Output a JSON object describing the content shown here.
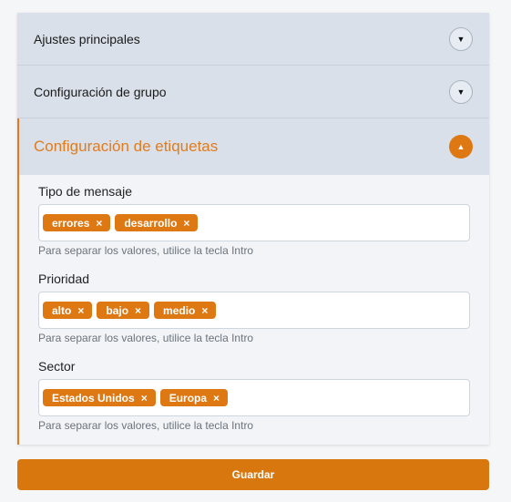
{
  "accordion": {
    "sections": [
      {
        "title": "Ajustes principales",
        "icon": "chevron-down-icon",
        "glyph": "▼"
      },
      {
        "title": "Configuración de grupo",
        "icon": "chevron-down-icon",
        "glyph": "▼"
      },
      {
        "title": "Configuración de etiquetas",
        "icon": "chevron-up-icon",
        "glyph": "▲",
        "expanded": true
      }
    ]
  },
  "fields": [
    {
      "label": "Tipo de mensaje",
      "tags": [
        "errores",
        "desarrollo"
      ],
      "help": "Para separar los valores, utilice la tecla Intro"
    },
    {
      "label": "Prioridad",
      "tags": [
        "alto",
        "bajo",
        "medio"
      ],
      "help": "Para separar los valores, utilice la tecla Intro"
    },
    {
      "label": "Sector",
      "tags": [
        "Estados Unidos",
        "Europa"
      ],
      "help": "Para separar los valores, utilice la tecla Intro"
    }
  ],
  "tag_remove_glyph": "×",
  "save_label": "Guardar",
  "colors": {
    "accent": "#de7812",
    "header_bg": "#d9e0e9",
    "body_bg": "#f2f4f7"
  }
}
